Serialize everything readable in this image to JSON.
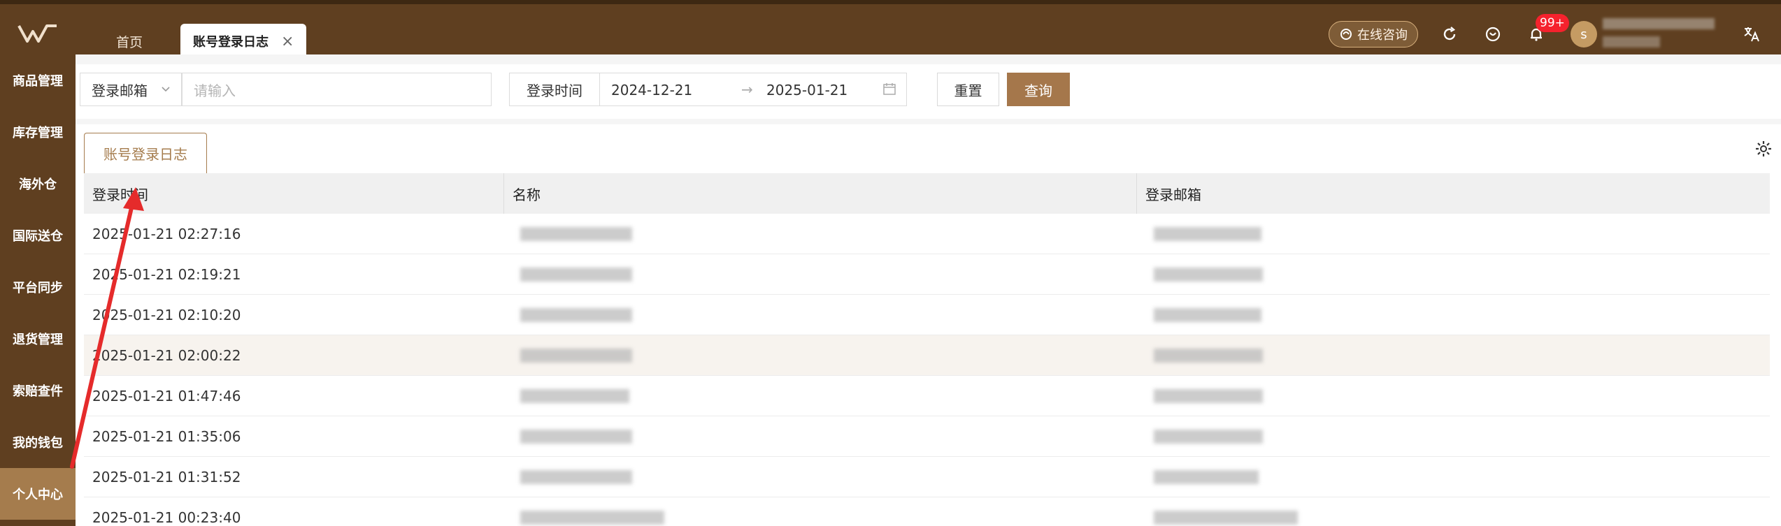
{
  "topbar": {
    "tabs": [
      {
        "label": "首页"
      },
      {
        "label": "账号登录日志",
        "close": "×"
      }
    ],
    "consult_label": "在线咨询",
    "notifications": "99+",
    "avatar_initial": "s"
  },
  "sidebar": {
    "items": [
      {
        "label": "商品管理"
      },
      {
        "label": "库存管理"
      },
      {
        "label": "海外仓"
      },
      {
        "label": "国际送仓"
      },
      {
        "label": "平台同步"
      },
      {
        "label": "退货管理"
      },
      {
        "label": "索赔查件"
      },
      {
        "label": "我的钱包"
      },
      {
        "label": "个人中心"
      }
    ]
  },
  "filter": {
    "email_select": "登录邮箱",
    "email_placeholder": "请输入",
    "time_label": "登录时间",
    "date_start": "2024-12-21",
    "date_end": "2025-01-21",
    "reset": "重置",
    "query": "查询"
  },
  "table": {
    "tab_label": "账号登录日志",
    "headers": [
      "登录时间",
      "名称",
      "登录邮箱"
    ],
    "rows": [
      {
        "time": "2025-01-21 02:27:16"
      },
      {
        "time": "2025-01-21 02:19:21"
      },
      {
        "time": "2025-01-21 02:10:20"
      },
      {
        "time": "2025-01-21 02:00:22"
      },
      {
        "time": "2025-01-21 01:47:46"
      },
      {
        "time": "2025-01-21 01:35:06"
      },
      {
        "time": "2025-01-21 01:31:52"
      },
      {
        "time": "2025-01-21 00:23:40"
      }
    ]
  },
  "colors": {
    "brand_brown": "#5f3f20",
    "accent": "#a5774b",
    "annotation_red": "#e52b2b"
  }
}
